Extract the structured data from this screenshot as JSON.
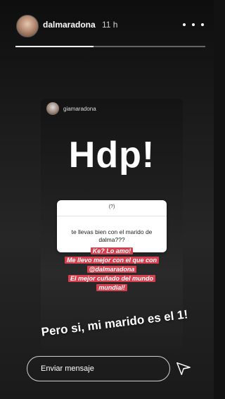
{
  "header": {
    "username": "dalmaradona",
    "time": "11 h",
    "progress": 0.41
  },
  "shared_story": {
    "username": "giamaradona",
    "headline": "Hdp!",
    "question_icon": "(?)",
    "question": "te llevas bien con el marido de dalma???",
    "answers": [
      "Ke? Lo amo!",
      "Me llevo mejor con el que con",
      "@dalmaradona",
      "El mejor cuñado del mundo",
      "mundial!"
    ]
  },
  "caption": "Pero si, mi marido es el 1!",
  "footer": {
    "message_placeholder": "Enviar mensaje",
    "send_icon": "paper-plane-icon"
  },
  "colors": {
    "answer_highlight": "#d9404f",
    "background": "#121212"
  }
}
